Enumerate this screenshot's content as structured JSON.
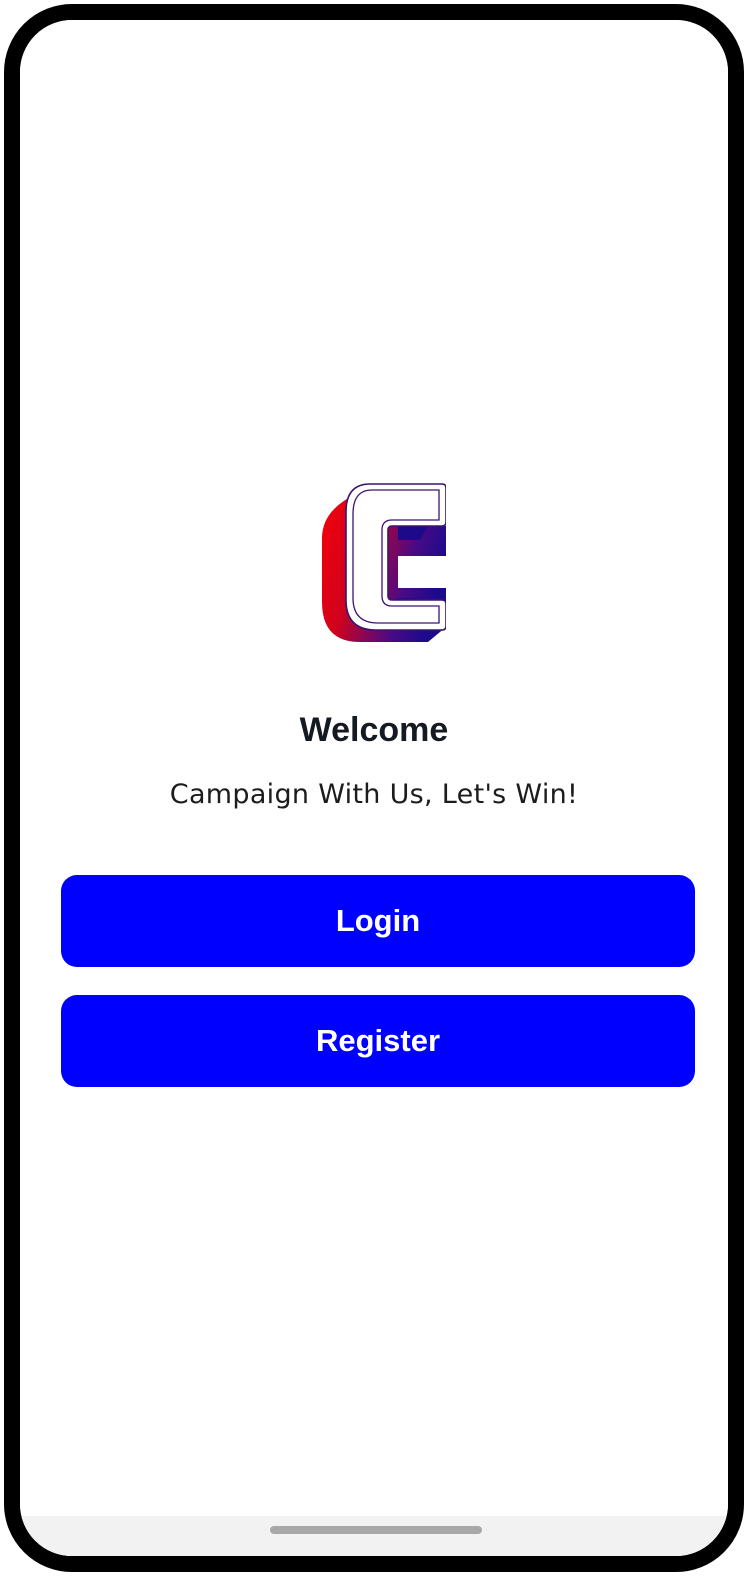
{
  "app": {
    "logo_icon": "campaign-c-logo-icon",
    "accent_color": "#0000ff",
    "logo_gradient": [
      "#e8000e",
      "#1a0a8c"
    ]
  },
  "welcome": {
    "title": "Welcome",
    "subtitle": "Campaign With Us, Let's Win!"
  },
  "actions": {
    "login_label": "Login",
    "register_label": "Register"
  },
  "navigation": {
    "home_indicator": "home-indicator-bar"
  }
}
